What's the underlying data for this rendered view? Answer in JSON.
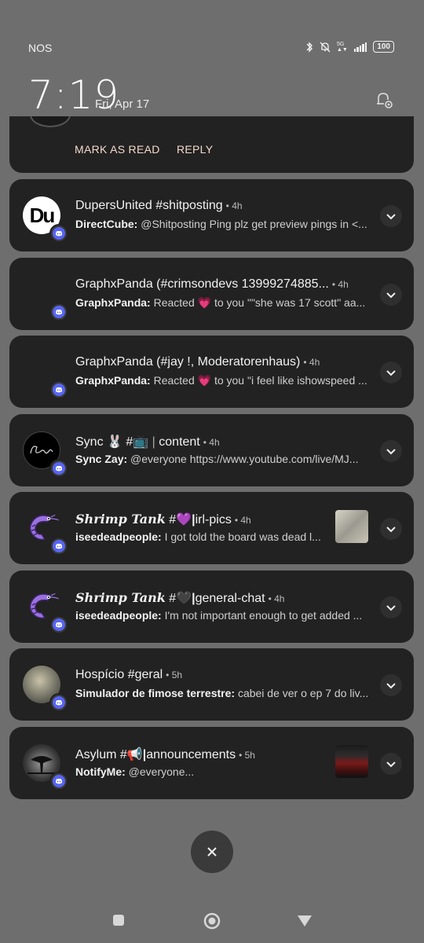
{
  "status_bar": {
    "carrier": "NOS",
    "network": "5G",
    "battery": "100"
  },
  "header": {
    "time": "7:19",
    "date": "Fri, Apr 17"
  },
  "top_notification": {
    "actions": [
      "MARK AS READ",
      "REPLY"
    ]
  },
  "notifications": [
    {
      "title": "DupersUnited #shitposting",
      "time": "• 4h",
      "sender": "DirectCube:",
      "text": "@Shitposting Ping plz get preview pings in <..."
    },
    {
      "title": "GraphxPanda (#crimsondevs 13999274885...",
      "time": "• 4h",
      "sender": "GraphxPanda:",
      "text": "Reacted 💗 to you \"\"she was 17 scott\" aa..."
    },
    {
      "title": "GraphxPanda (#jay !, Moderatorenhaus)",
      "time": "• 4h",
      "sender": "GraphxPanda:",
      "text": "Reacted 💗 to you \"i feel like ishowspeed ..."
    },
    {
      "title_a": "Sync 🐰 #📺",
      "title_b": "content",
      "time": "• 4h",
      "sender": "Sync Zay:",
      "text": "@everyone https://www.youtube.com/live/MJ..."
    },
    {
      "title_a": "Shrimp Tank",
      "title_b": "#💜",
      "title_c": "irl-pics",
      "time": "• 4h",
      "sender": "iseedeadpeople:",
      "text": "I got told the board was dead l..."
    },
    {
      "title_a": "Shrimp Tank",
      "title_b": "#🖤",
      "title_c": "general-chat",
      "time": "• 4h",
      "sender": "iseedeadpeople:",
      "text": "I'm not important enough to get added ..."
    },
    {
      "title": "Hospício #geral",
      "time": "• 5h",
      "sender": "Simulador de fimose terrestre:",
      "text": "cabei de ver o ep 7 do liv..."
    },
    {
      "title_a": "Asylum #📢",
      "title_b": "announcements",
      "time": "• 5h",
      "sender": "NotifyMe:",
      "text": "@everyone..."
    }
  ],
  "icons": {
    "settings": "settings-gear-icon",
    "expand": "chevron-down-icon",
    "clear": "close-icon",
    "app_badge": "discord-icon",
    "nav": [
      "recents-square-icon",
      "home-circle-icon",
      "back-triangle-icon"
    ]
  },
  "colors": {
    "background": "#6e6e6e",
    "card": "#222222",
    "action_text": "#f5d9c9",
    "discord": "#5865f2",
    "shrimp": "#9b6fe0"
  }
}
